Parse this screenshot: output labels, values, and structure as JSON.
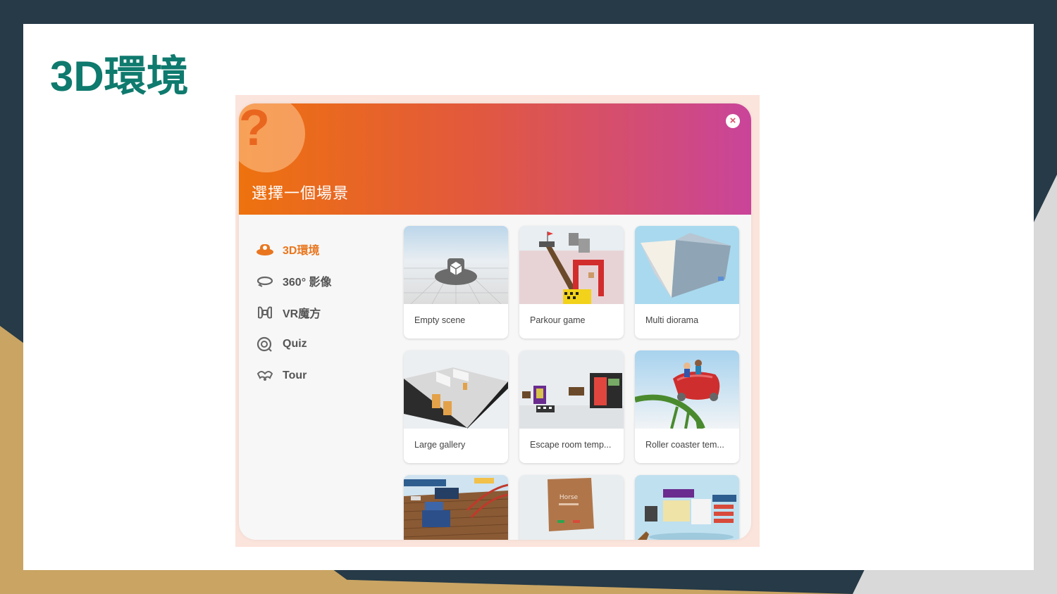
{
  "slide": {
    "title": "3D環境"
  },
  "dialog": {
    "title": "選擇一個場景",
    "help_mark": "?",
    "close_glyph": "×"
  },
  "sidebar": {
    "items": [
      {
        "label": "3D環境",
        "icon": "hat-icon",
        "active": true
      },
      {
        "label": "360° 影像",
        "icon": "rotate-360-icon",
        "active": false
      },
      {
        "label": "VR魔方",
        "icon": "merge-cube-icon",
        "active": false
      },
      {
        "label": "Quiz",
        "icon": "quiz-icon",
        "active": false
      },
      {
        "label": "Tour",
        "icon": "tour-icon",
        "active": false
      }
    ]
  },
  "scenes": [
    {
      "label": "Empty scene"
    },
    {
      "label": "Parkour game"
    },
    {
      "label": "Multi diorama"
    },
    {
      "label": "Large gallery"
    },
    {
      "label": "Escape room temp..."
    },
    {
      "label": "Roller coaster tem..."
    },
    {
      "label": ""
    },
    {
      "label": "Horse"
    },
    {
      "label": ""
    }
  ],
  "colors": {
    "slide_title": "#0f7a6e",
    "active_item": "#e9761e",
    "header_start": "#ee720e",
    "header_end": "#c9449a"
  }
}
